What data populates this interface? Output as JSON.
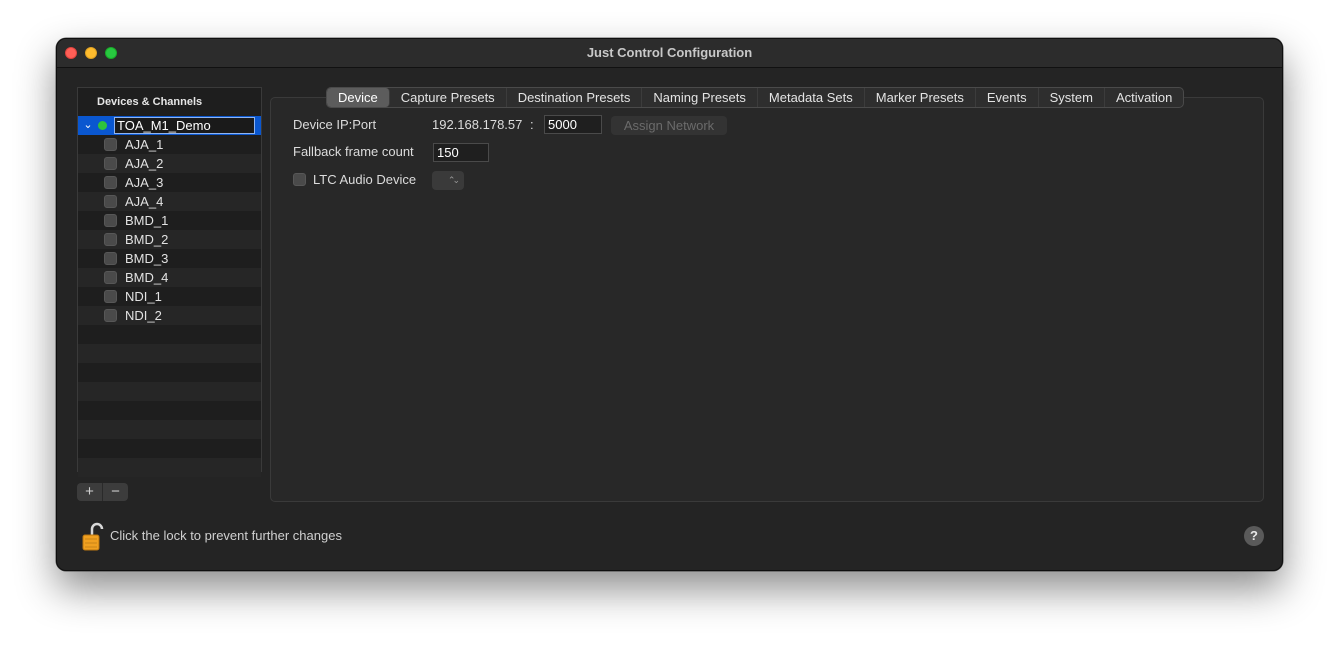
{
  "window": {
    "title": "Just Control Configuration"
  },
  "sidebar": {
    "header": "Devices & Channels",
    "device": {
      "name": "TOA_M1_Demo",
      "status_color": "#2ec43a"
    },
    "channels": [
      {
        "label": "AJA_1"
      },
      {
        "label": "AJA_2"
      },
      {
        "label": "AJA_3"
      },
      {
        "label": "AJA_4"
      },
      {
        "label": "BMD_1"
      },
      {
        "label": "BMD_2"
      },
      {
        "label": "BMD_3"
      },
      {
        "label": "BMD_4"
      },
      {
        "label": "NDI_1"
      },
      {
        "label": "NDI_2"
      }
    ],
    "add_label": "+",
    "remove_label": "−"
  },
  "tabs": [
    {
      "label": "Device",
      "active": true
    },
    {
      "label": "Capture Presets"
    },
    {
      "label": "Destination Presets"
    },
    {
      "label": "Naming Presets"
    },
    {
      "label": "Metadata Sets"
    },
    {
      "label": "Marker Presets"
    },
    {
      "label": "Events"
    },
    {
      "label": "System"
    },
    {
      "label": "Activation"
    }
  ],
  "device": {
    "ip_label": "Device IP:Port",
    "ip_value": "192.168.178.57",
    "colon": ":",
    "port_value": "5000",
    "assign_button": "Assign Network",
    "fallback_label": "Fallback frame count",
    "fallback_value": "150",
    "ltc_label": "LTC Audio Device",
    "ltc_popup_glyph": "⌃⌄"
  },
  "footer": {
    "lock_text": "Click the lock to prevent further changes",
    "help_label": "?"
  },
  "colors": {
    "selection": "#0a57d0",
    "accent_green": "#2ec43a",
    "lock": "#f0a020"
  }
}
